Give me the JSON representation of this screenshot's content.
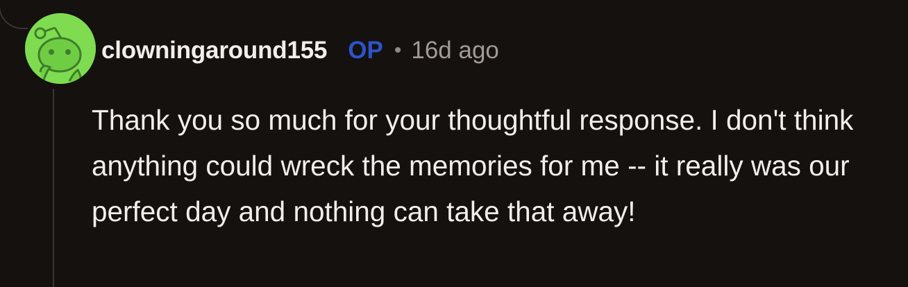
{
  "comment": {
    "author": {
      "username": "clowningaround155",
      "badge": "OP",
      "avatar_icon": "snoo-avatar-icon"
    },
    "separator": "•",
    "timestamp": "16d ago",
    "body": "Thank you so much for your thoughtful response. I don't think anything could wreck the memories for me -- it really was our perfect day and nothing can take that away!"
  },
  "colors": {
    "background": "#14110f",
    "text": "#f2efeb",
    "op_badge": "#2e52c9",
    "timestamp": "#a19b96",
    "avatar_bg": "#7fdc51",
    "thread_line": "#3a3633"
  }
}
